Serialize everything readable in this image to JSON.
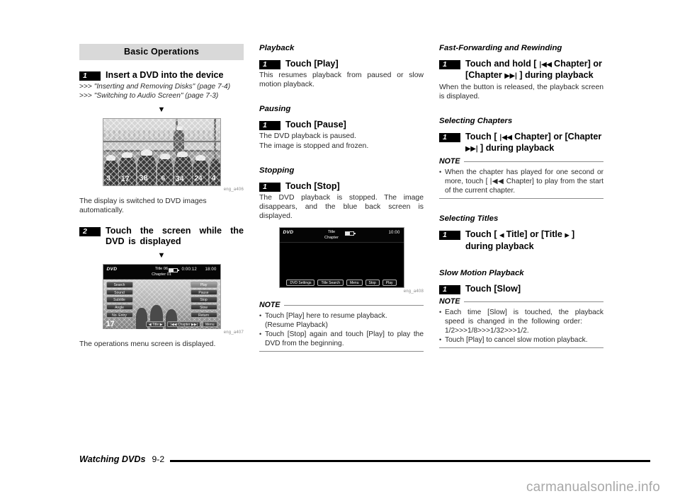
{
  "banner": {
    "title": "Basic Operations"
  },
  "left_column": {
    "step1": {
      "number": "1",
      "text": "Insert a DVD into the device",
      "refs": [
        {
          "arrows": ">>>",
          "text": "\"Inserting and Removing Disks\" (page 7-4)"
        },
        {
          "arrows": ">>>",
          "text": "\"Switching to Audio Screen\" (page 7-3)"
        }
      ],
      "arrow_glyph": "▼"
    },
    "figure1": {
      "caption": "eng_a406",
      "player_numbers": [
        "3",
        "17",
        "38",
        "6",
        "34",
        "24",
        "4"
      ],
      "after_text": "The display is switched to DVD images automatically."
    },
    "step2": {
      "number": "2",
      "text": "Touch the screen while the DVD is displayed",
      "arrow_glyph": "▼"
    },
    "figure2": {
      "caption": "eng_a407",
      "after_text": "The operations menu screen is displayed.",
      "screen": {
        "logo": "DVD",
        "title": "Title 06",
        "chapter": "Chapter 01",
        "elapsed": "0:00:12",
        "clock": "18:00",
        "left_buttons": [
          "Search",
          "Sound",
          "Subtitle",
          "Angle",
          "No. Entry"
        ],
        "right_buttons": [
          "Play",
          "Pause",
          "Stop",
          "Slow",
          "Return"
        ],
        "bottom_buttons": [
          "◀ Title ▶",
          "|◀◀ Chapter ▶▶|",
          "Menu"
        ],
        "video_number": "17"
      }
    }
  },
  "middle_column": {
    "sections": [
      {
        "heading": "Playback",
        "step_number": "1",
        "step_text": "Touch [Play]",
        "body": "This resumes playback from paused or slow motion playback."
      },
      {
        "heading": "Pausing",
        "step_number": "1",
        "step_text": "Touch [Pause]",
        "body_line1": "The DVD playback is paused.",
        "body_line2": "The image is stopped and frozen."
      },
      {
        "heading": "Stopping",
        "step_number": "1",
        "step_text": "Touch [Stop]",
        "body": "The DVD playback is stopped. The image disappears, and the blue back screen is displayed."
      }
    ],
    "figure3": {
      "caption": "eng_a408",
      "screen": {
        "logo": "DVD",
        "title": "Title",
        "chapter": "Chapter",
        "clock": "10:00",
        "toolbar_buttons": [
          "DVD Settings",
          "Title Search",
          "Menu",
          "Stop",
          "Play"
        ]
      }
    },
    "note": {
      "label": "NOTE",
      "items": [
        "Touch [Play] here to resume playback.",
        "(Resume Playback)",
        "Touch [Stop] again and touch [Play] to play the DVD from the beginning."
      ]
    }
  },
  "right_column": {
    "sections": [
      {
        "heading": "Fast-Forwarding and Rewinding",
        "step_number": "1",
        "step_prefix": "Touch and hold [ ",
        "step_icon_back": "|◀◀",
        "step_mid": " Chapter] or [Chapter ",
        "step_icon_fwd": "▶▶|",
        "step_suffix": " ] during playback",
        "body": "When the button is released, the playback screen is displayed."
      },
      {
        "heading": "Selecting Chapters",
        "step_number": "1",
        "step_prefix": "Touch [ ",
        "step_icon_back": "|◀◀",
        "step_mid": " Chapter] or [Chapter ",
        "step_icon_fwd": "▶▶|",
        "step_suffix": " ] during playback",
        "note": {
          "label": "NOTE",
          "items": [
            "When the chapter has played for one second or more, touch [ |◀◀ Chapter] to play from the start of the current chapter."
          ]
        }
      },
      {
        "heading": "Selecting Titles",
        "step_number": "1",
        "step_prefix": "Touch [ ",
        "step_icon_back": "◀",
        "step_mid": " Title] or [Title ",
        "step_icon_fwd": "▶",
        "step_suffix": " ] during playback"
      },
      {
        "heading": "Slow Motion Playback",
        "step_number": "1",
        "step_text": "Touch [Slow]",
        "note": {
          "label": "NOTE",
          "items": [
            "Each time [Slow] is touched, the playback speed is changed in the following order:",
            "1/2>>>1/8>>>1/32>>>1/2.",
            "Touch [Play] to cancel slow motion playback."
          ]
        }
      }
    ]
  },
  "footer": {
    "chapter": "Watching DVDs",
    "page": "9-2"
  },
  "watermark": "carmanualsonline.info"
}
